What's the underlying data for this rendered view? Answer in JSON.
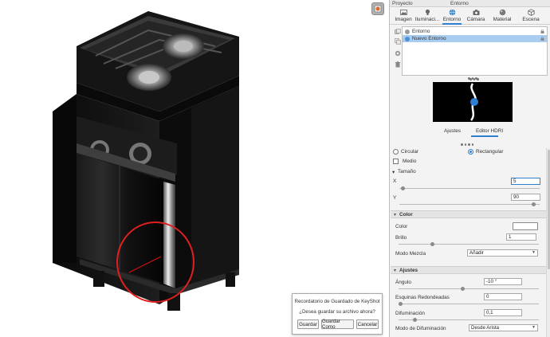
{
  "panel": {
    "project_label": "Proyecto",
    "title": "Entorno"
  },
  "tabs": [
    {
      "label": "Imagen",
      "icon": "image-icon"
    },
    {
      "label": "Iluminaci...",
      "icon": "light-bulb-icon"
    },
    {
      "label": "Entorno",
      "icon": "globe-icon",
      "active": true
    },
    {
      "label": "Cámara",
      "icon": "camera-icon"
    },
    {
      "label": "Material",
      "icon": "material-sphere-icon"
    },
    {
      "label": "Escena",
      "icon": "scene-cube-icon"
    }
  ],
  "environments": [
    {
      "name": "Entorno",
      "selected": false
    },
    {
      "name": "Nuevo Entorno",
      "selected": true
    }
  ],
  "subtabs": {
    "adjustments": "Ajustes",
    "hdri_editor": "Editor HDRI"
  },
  "shape": {
    "circular": "Circular",
    "rectangular": "Rectangular",
    "selected": "rectangular",
    "half_label": "Medio"
  },
  "size": {
    "title": "Tamaño",
    "x_label": "X",
    "x_value": "5",
    "y_label": "Y",
    "y_value": "90"
  },
  "color_section": {
    "title": "Color",
    "color_label": "Color",
    "brightness_label": "Brillo",
    "brightness_value": "1",
    "blend_label": "Modo Mezcla",
    "blend_value": "Añadir"
  },
  "adjust_section": {
    "title": "Ajustes",
    "angle_label": "Ángulo",
    "angle_value": "-10 °",
    "corners_label": "Esquinas Redondeadas",
    "corners_value": "0",
    "falloff_label": "Difuminación",
    "falloff_value": "0,1",
    "falloff_mode_label": "Modo de Difuminación",
    "falloff_mode_value": "Desde Arista"
  },
  "dialog": {
    "title": "Recordatorio de Guardado de KeyShot",
    "message": "¿Desea guardar su archivo ahora?",
    "save": "Guardar",
    "save_as": "Guardar Como",
    "cancel": "Cancelar"
  },
  "colors": {
    "accent": "#2f7fd0",
    "selection": "#a9cdf0",
    "annotation_circle": "#e02020"
  }
}
